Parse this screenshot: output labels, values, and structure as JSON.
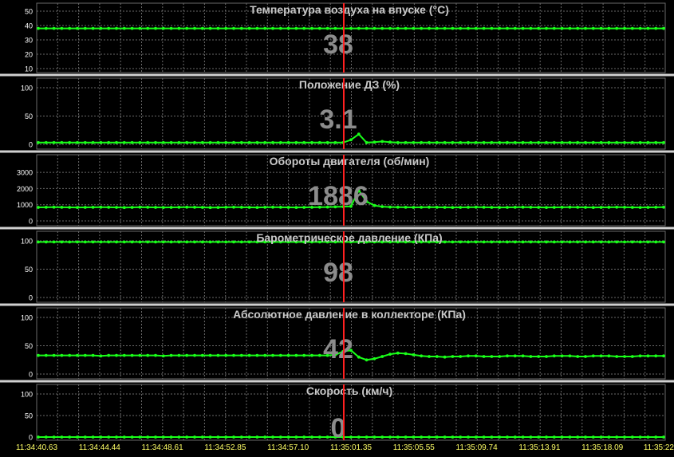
{
  "colors": {
    "background": "#000000",
    "separator": "#d0d0d0",
    "grid": "#6a6a6a",
    "trace": "#19ff19",
    "marker": "#ff2020",
    "title": "#c8c8c8",
    "big_value": "#8c8c8c",
    "tick": "#ffffff",
    "time_label": "#ffff66"
  },
  "chart_data": [
    {
      "type": "line",
      "title": "Температура воздуха на впуске  (°C)",
      "current_value": "38",
      "ylim": [
        10,
        50
      ],
      "yticks": [
        "50",
        "40",
        "30",
        "20",
        "10"
      ],
      "grid": true,
      "series": [
        {
          "values": [
            38,
            38,
            38,
            38,
            38,
            38,
            38,
            38,
            38,
            38,
            38,
            38,
            38,
            38,
            38,
            38,
            38,
            38,
            38,
            38,
            38,
            38,
            38,
            38,
            38,
            38,
            38,
            38,
            38,
            38,
            38,
            38,
            38,
            38,
            38,
            38,
            38,
            38,
            38,
            38,
            38,
            38,
            38,
            38,
            38,
            38,
            38,
            38,
            38,
            38,
            38,
            38,
            38,
            38,
            38,
            38,
            38,
            38,
            38,
            38,
            38,
            38,
            38,
            38,
            38,
            38,
            38,
            38,
            38,
            38,
            38,
            38,
            38,
            38,
            38,
            38,
            38,
            38,
            38,
            38,
            38
          ]
        }
      ]
    },
    {
      "type": "line",
      "title": "Положение ДЗ  (%)",
      "current_value": "3.1",
      "ylim": [
        0,
        100
      ],
      "yticks": [
        "100",
        "50",
        "0"
      ],
      "grid": true,
      "series": [
        {
          "values": [
            3.1,
            3.1,
            3.1,
            3.1,
            3.1,
            3.1,
            3.1,
            3.1,
            3.1,
            3.1,
            3.1,
            3.1,
            3.1,
            3.1,
            3.1,
            3.1,
            3.1,
            3.1,
            3.1,
            3.1,
            3.1,
            3.1,
            3.1,
            3.1,
            3.1,
            3.1,
            3.1,
            3.1,
            3.1,
            3.1,
            3.1,
            3.1,
            3.1,
            3.1,
            3.1,
            3.1,
            3.1,
            3.1,
            3.1,
            3.1,
            8,
            18,
            3.1,
            4,
            5,
            4,
            3.1,
            3.1,
            3.1,
            3.1,
            3.1,
            3.1,
            3.1,
            3.1,
            3.1,
            3.1,
            3.1,
            3.1,
            3.1,
            3.1,
            3.1,
            3.1,
            3.1,
            3.1,
            3.1,
            3.1,
            3.1,
            3.1,
            3.1,
            3.1,
            3.1,
            3.1,
            3.1,
            3.1,
            3.1,
            3.1,
            3.1,
            3.1,
            3.1,
            3.1,
            3.1
          ]
        }
      ]
    },
    {
      "type": "line",
      "title": "Обороты двигателя  (об/мин)",
      "current_value": "1886",
      "ylim": [
        0,
        3500
      ],
      "yticks": [
        "3000",
        "2000",
        "1000",
        "0"
      ],
      "grid": true,
      "series": [
        {
          "values": [
            840,
            845,
            850,
            845,
            840,
            835,
            840,
            845,
            850,
            845,
            840,
            830,
            840,
            850,
            845,
            840,
            835,
            840,
            845,
            850,
            845,
            840,
            830,
            835,
            845,
            850,
            845,
            840,
            835,
            845,
            850,
            845,
            840,
            835,
            840,
            845,
            850,
            860,
            870,
            880,
            900,
            1886,
            1200,
            950,
            880,
            860,
            850,
            845,
            840,
            845,
            850,
            845,
            840,
            835,
            840,
            845,
            850,
            845,
            840,
            835,
            840,
            845,
            850,
            845,
            840,
            835,
            840,
            845,
            850,
            845,
            840,
            835,
            840,
            845,
            850,
            845,
            840,
            835,
            840,
            845,
            850
          ]
        }
      ]
    },
    {
      "type": "line",
      "title": "Барометрическое давление  (КПа)",
      "current_value": "98",
      "ylim": [
        0,
        100
      ],
      "yticks": [
        "100",
        "50",
        "0"
      ],
      "grid": true,
      "series": [
        {
          "values": [
            98,
            98,
            98,
            98,
            98,
            98,
            98,
            98,
            98,
            98,
            98,
            98,
            98,
            98,
            98,
            98,
            98,
            98,
            98,
            98,
            98,
            98,
            98,
            98,
            98,
            98,
            98,
            98,
            98,
            98,
            98,
            98,
            98,
            98,
            98,
            98,
            98,
            98,
            98,
            98,
            98,
            98,
            98,
            98,
            98,
            98,
            98,
            98,
            98,
            98,
            98,
            98,
            98,
            98,
            98,
            98,
            98,
            98,
            98,
            98,
            98,
            98,
            98,
            98,
            98,
            98,
            98,
            98,
            98,
            98,
            98,
            98,
            98,
            98,
            98,
            98,
            98,
            98,
            98,
            98,
            98
          ]
        }
      ]
    },
    {
      "type": "line",
      "title": "Абсолютное давление в коллекторе  (КПа)",
      "current_value": "42",
      "ylim": [
        0,
        100
      ],
      "yticks": [
        "100",
        "50",
        "0"
      ],
      "grid": true,
      "series": [
        {
          "values": [
            33,
            33,
            33,
            33,
            33,
            33,
            33,
            33,
            32,
            33,
            33,
            33,
            33,
            33,
            33,
            33,
            32,
            33,
            33,
            33,
            33,
            33,
            33,
            33,
            33,
            33,
            33,
            33,
            33,
            33,
            33,
            33,
            33,
            33,
            33,
            33,
            33,
            33,
            34,
            40,
            42,
            30,
            25,
            27,
            31,
            35,
            37,
            36,
            34,
            32,
            31,
            31,
            30,
            31,
            31,
            32,
            32,
            31,
            31,
            31,
            32,
            32,
            32,
            31,
            31,
            31,
            32,
            32,
            32,
            31,
            31,
            32,
            32,
            32,
            31,
            31,
            31,
            32,
            32,
            32,
            32
          ]
        }
      ]
    },
    {
      "type": "line",
      "title": "Скорость  (км/ч)",
      "current_value": "0",
      "ylim": [
        0,
        100
      ],
      "yticks": [
        "100",
        "50",
        "0"
      ],
      "grid": true,
      "series": [
        {
          "values": [
            0,
            0,
            0,
            0,
            0,
            0,
            0,
            0,
            0,
            0,
            0,
            0,
            0,
            0,
            0,
            0,
            0,
            0,
            0,
            0,
            0,
            0,
            0,
            0,
            0,
            0,
            0,
            0,
            0,
            0,
            0,
            0,
            0,
            0,
            0,
            0,
            0,
            0,
            0,
            0,
            0,
            0,
            0,
            0,
            0,
            0,
            0,
            0,
            0,
            0,
            0,
            0,
            0,
            0,
            0,
            0,
            0,
            0,
            0,
            0,
            0,
            0,
            0,
            0,
            0,
            0,
            0,
            0,
            0,
            0,
            0,
            0,
            0,
            0,
            0,
            0,
            0,
            0,
            0,
            0,
            0
          ]
        }
      ]
    }
  ],
  "time_axis": {
    "labels": [
      "11:34:40.63",
      "11:34:44.44",
      "11:34:48.61",
      "11:34:52.85",
      "11:34:57.10",
      "11:35:01.35",
      "11:35:05.55",
      "11:35:09.74",
      "11:35:13.91",
      "11:35:18.09",
      "11:35:22"
    ]
  },
  "cursor": {
    "index": 40
  }
}
